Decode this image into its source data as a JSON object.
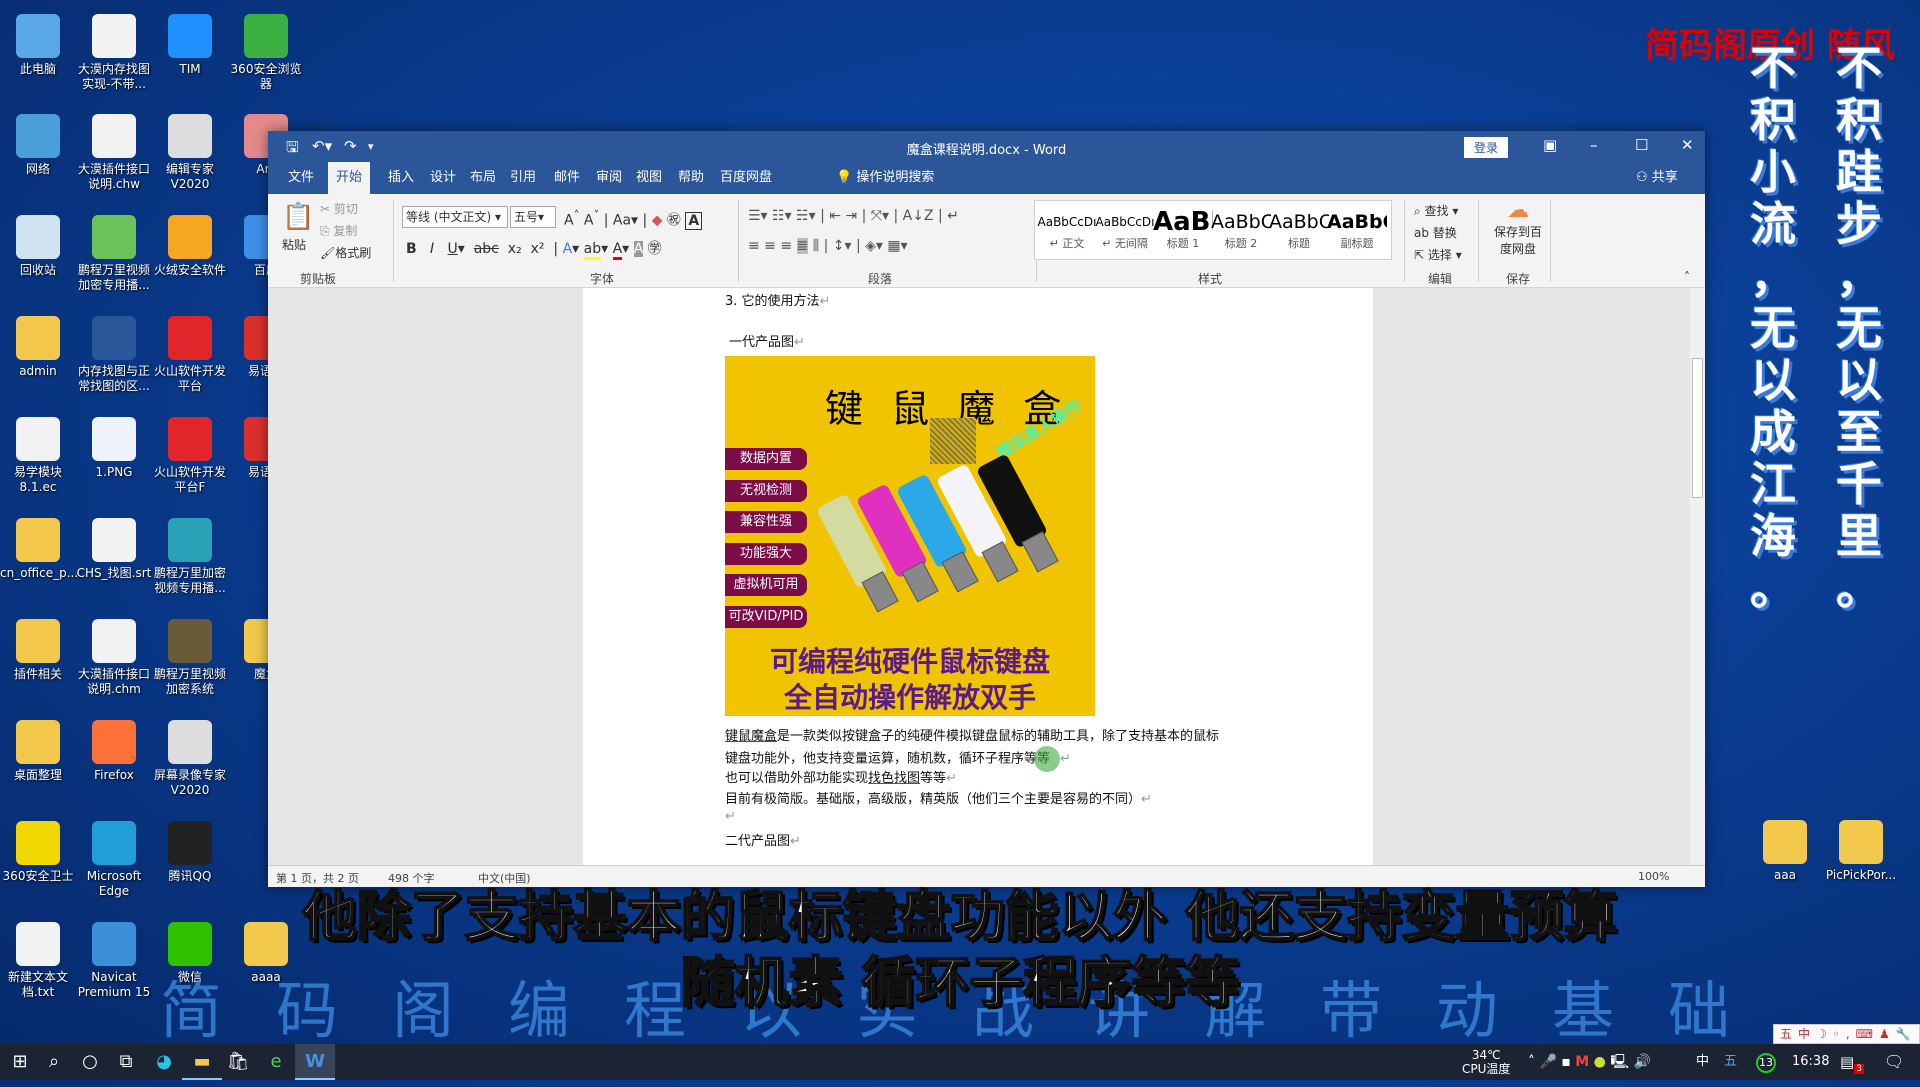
{
  "desktop": {
    "icons": [
      {
        "label": "此电脑",
        "color": "#5aa7e8"
      },
      {
        "label": "大漠内存找图实现-不带...",
        "color": "#f2f2f2"
      },
      {
        "label": "TIM",
        "color": "#1e90ff"
      },
      {
        "label": "360安全浏览器",
        "color": "#3cb043"
      },
      {
        "label": "网络",
        "color": "#4a9fd8"
      },
      {
        "label": "大漠插件接口说明.chw",
        "color": "#f2f2f2"
      },
      {
        "label": "编辑专家V2020",
        "color": "#ddd"
      },
      {
        "label": "Anl",
        "color": "#e58a8a"
      },
      {
        "label": "回收站",
        "color": "#cfe3f0"
      },
      {
        "label": "鹏程万里视频加密专用播...",
        "color": "#6ac259"
      },
      {
        "label": "火绒安全软件",
        "color": "#f5a623"
      },
      {
        "label": "百度",
        "color": "#3f8ee8"
      },
      {
        "label": "admin",
        "color": "#f2c94c"
      },
      {
        "label": "内存找图与正常找图的区...",
        "color": "#2b579a"
      },
      {
        "label": "火山软件开发平台",
        "color": "#e0262b"
      },
      {
        "label": "易语言",
        "color": "#d9302c"
      },
      {
        "label": "易学模块8.1.ec",
        "color": "#f2f2f2"
      },
      {
        "label": "1.PNG",
        "color": "#eef3fb"
      },
      {
        "label": "火山软件开发平台F",
        "color": "#e0262b"
      },
      {
        "label": "易语言",
        "color": "#d9302c"
      },
      {
        "label": "cn_office_p...",
        "color": "#f2c94c"
      },
      {
        "label": "CHS_找图.srt",
        "color": "#f2f2f2"
      },
      {
        "label": "鹏程万里加密视频专用播...",
        "color": "#2aa3b8"
      },
      {
        "label": "",
        "color": "#0000"
      },
      {
        "label": "插件相关",
        "color": "#f2c94c"
      },
      {
        "label": "大漠插件接口说明.chm",
        "color": "#f2f2f2"
      },
      {
        "label": "鹏程万里视频加密系统",
        "color": "#6b5a3a"
      },
      {
        "label": "魔盒",
        "color": "#f2c94c"
      },
      {
        "label": "桌面整理",
        "color": "#f2c94c"
      },
      {
        "label": "Firefox",
        "color": "#ff7139"
      },
      {
        "label": "屏幕录像专家V2020",
        "color": "#ddd"
      },
      {
        "label": "",
        "color": "#0000"
      },
      {
        "label": "360安全卫士",
        "color": "#f2d600"
      },
      {
        "label": "Microsoft Edge",
        "color": "#1f9ed8"
      },
      {
        "label": "腾讯QQ",
        "color": "#222"
      },
      {
        "label": "",
        "color": "#0000"
      },
      {
        "label": "新建文本文档.txt",
        "color": "#f2f2f2"
      },
      {
        "label": "Navicat Premium 15",
        "color": "#3a8fd8"
      },
      {
        "label": "微信",
        "color": "#2dc100"
      },
      {
        "label": "aaaa",
        "color": "#f2c94c"
      }
    ],
    "right_icons": [
      {
        "label": "aaa",
        "color": "#f2c94c"
      },
      {
        "label": "PicPickPor...",
        "color": "#f2c94c"
      }
    ]
  },
  "word": {
    "title": "魔盒课程说明.docx  -  Word",
    "login": "登录",
    "share": "共享",
    "tabs": [
      "文件",
      "开始",
      "插入",
      "设计",
      "布局",
      "引用",
      "邮件",
      "审阅",
      "视图",
      "帮助",
      "百度网盘"
    ],
    "active_tab": "开始",
    "tell_me": "操作说明搜索",
    "ribbon": {
      "clipboard": {
        "paste": "粘贴",
        "cut": "剪切",
        "copy": "复制",
        "format_painter": "格式刷",
        "label": "剪贴板"
      },
      "font": {
        "name": "等线 (中文正文)",
        "size": "五号",
        "label": "字体"
      },
      "paragraph": {
        "label": "段落"
      },
      "styles": {
        "items": [
          {
            "sample": "AaBbCcDı",
            "name": "↵ 正文"
          },
          {
            "sample": "AaBbCcDı",
            "name": "↵ 无间隔"
          },
          {
            "sample": "AaBl",
            "name": "标题 1"
          },
          {
            "sample": "AaBbC",
            "name": "标题 2"
          },
          {
            "sample": "AaBbC",
            "name": "标题"
          },
          {
            "sample": "AaBbC",
            "name": "副标题"
          }
        ],
        "label": "样式"
      },
      "editing": {
        "find": "查找",
        "replace": "替换",
        "select": "选择",
        "label": "编辑"
      },
      "save": {
        "button": "保存到百度网盘",
        "label": "保存"
      }
    },
    "document": {
      "heading3": "3.   它的使用方法",
      "gen1": "一代产品图",
      "image": {
        "title": "键 鼠 魔 盒",
        "badges": [
          "数据内置",
          "无视检测",
          "兼容性强",
          "功能强大",
          "虚拟机可用",
          "可改VID/PID"
        ],
        "slogan": "模拟真人操作",
        "bottom1": "可编程纯硬件鼠标键盘",
        "bottom2": "全自动操作解放双手"
      },
      "p1_link": "键鼠魔盒",
      "p1": "是一款类似按键盒子的纯硬件模拟键盘鼠标的辅助工具，除了支持基本的鼠标",
      "p2": "键盘功能外，他支持变量运算，随机数，循环子程序等等",
      "p3a": "也可以借助外部功能实现",
      "p3_link": "找色找图",
      "p3b": "等等",
      "p4": "目前有极简版。基础版，高级版，精英版（他们三个主要是容易的不同）",
      "gen2": "二代产品图",
      "mark": "↵"
    },
    "status": {
      "page": "第 1 页，共 2 页",
      "words": "498 个字",
      "lang": "中文(中国)",
      "zoom": "100%"
    }
  },
  "overlay": {
    "brand": "简码阁原创  随风",
    "vertical_left": "不积小流，无以成江海。",
    "vertical_right": "不积跬步，无以至千里。",
    "subtitle1": "他除了支持基本的鼠标键盘功能以外 他还支持变量预算",
    "subtitle2": "随机素 循环子程序等等",
    "watermark": "简码阁编程以实战讲解带动基础"
  },
  "taskbar": {
    "apps": [
      "windows-start",
      "search",
      "cortana",
      "task-view",
      "edge",
      "file-explorer",
      "store",
      "360-browser",
      "word"
    ],
    "temp": "34℃",
    "temp_label": "CPU温度",
    "ime_lang": "中",
    "ime": "五",
    "badge_count": "13",
    "time": "16:38",
    "notif_count": "3",
    "ime_bar": "五中☽◦,⌨♟🔧"
  }
}
